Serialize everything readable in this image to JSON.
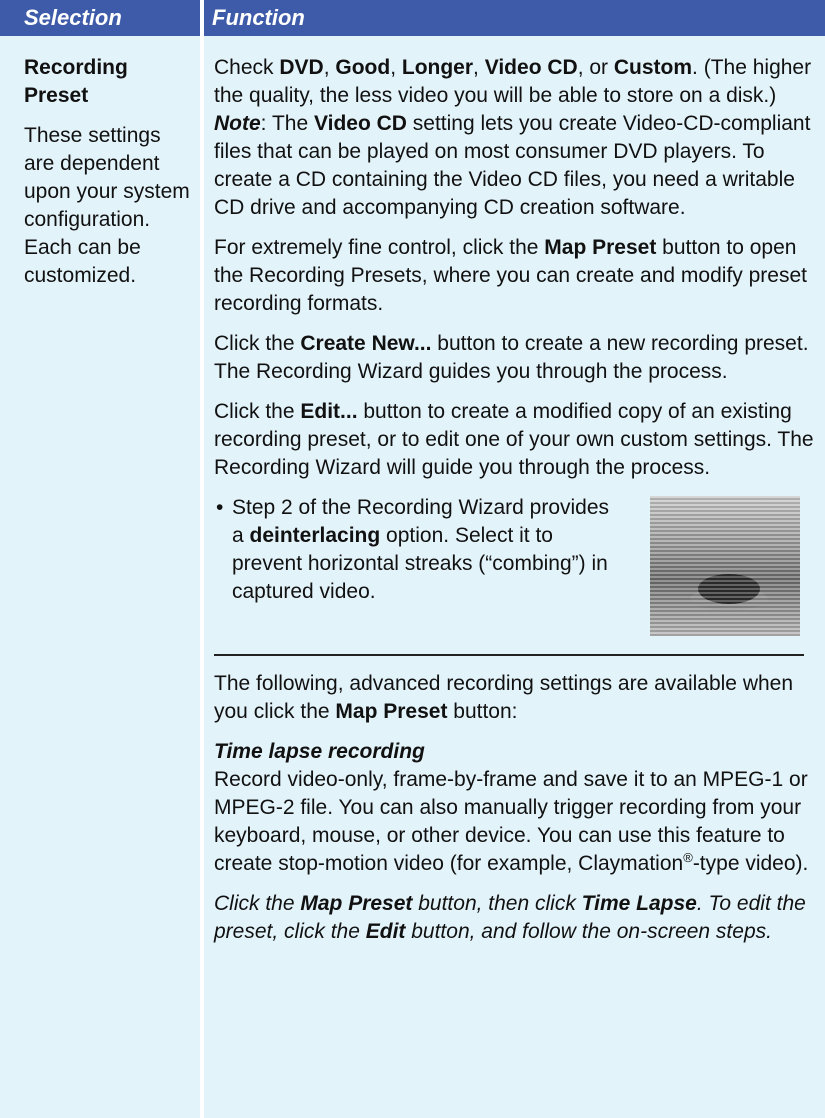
{
  "header": {
    "selection": "Selection",
    "function": "Function"
  },
  "left": {
    "title": "Recording Preset",
    "desc": "These settings are dependent upon your system configuration. Each can be customized."
  },
  "right": {
    "p1": {
      "a": "Check ",
      "b1": "DVD",
      "c": ", ",
      "b2": "Good",
      "d": ", ",
      "b3": "Longer",
      "e": ", ",
      "b4": "Video CD",
      "f": ", or ",
      "b5": "Custom",
      "g": ". (The higher the quality, the less video you will be able to store on a disk.)"
    },
    "note": {
      "label": "Note",
      "a": ": The ",
      "b": "Video CD",
      "c": " setting lets you create Video-CD-compliant files that can be played on most consumer DVD players. To create a CD containing the Video CD files, you need a writable CD drive and accompanying CD creation software."
    },
    "p2": {
      "a": "For extremely fine control, click the ",
      "b": "Map Preset",
      "c": " button to open the Recording Presets, where you can create and modify preset recording formats."
    },
    "p3": {
      "a": "Click the ",
      "b": "Create New...",
      "c": " button to create a new recording preset. The Recording Wizard guides you through the process."
    },
    "p4": {
      "a": "Click the ",
      "b": "Edit...",
      "c": " button to create a modified copy of an existing recording preset, or to edit one of your own custom settings. The Recording Wizard will guide you through the process."
    },
    "bullet": {
      "dot": "•",
      "a": "Step 2 of the Recording Wizard provides a ",
      "b": "deinterlacing",
      "c": " option. Select it to prevent horizontal streaks (“combing”) in captured video."
    },
    "p5": {
      "a": "The following, advanced recording settings are available when you click the ",
      "b": "Map Preset",
      "c": " button:"
    },
    "timelapse": {
      "heading": "Time lapse recording",
      "body_a": "Record video-only, frame-by-frame and save it to an MPEG-1 or MPEG-2 file. You can also manually trigger recording from your keyboard, mouse, or other device. You can use this feature to create stop-motion video (for example, Claymation",
      "reg": "®",
      "body_b": "-type video)."
    },
    "p6": {
      "a": "Click the ",
      "b": "Map Preset",
      "c": " button, then click ",
      "d": "Time Lapse",
      "e": ". To edit the preset, click the ",
      "f": "Edit",
      "g": " button, and follow the on-screen steps."
    }
  }
}
